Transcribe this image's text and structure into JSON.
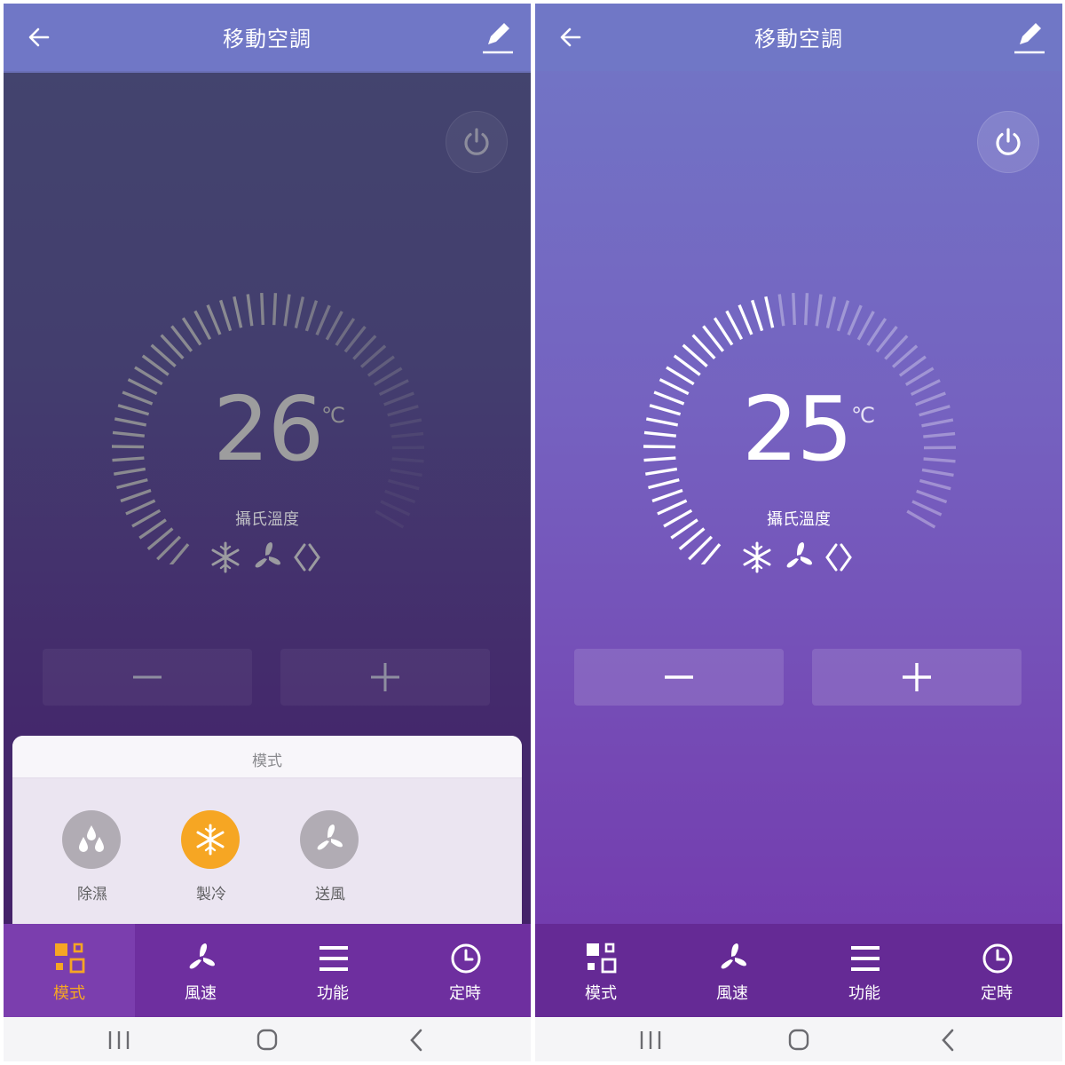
{
  "colors": {
    "accent": "#f6a623",
    "header": "#7077c6",
    "nav_bg": "#6e2f9f"
  },
  "panels": [
    {
      "state": "power-off",
      "header": {
        "title": "移動空調",
        "back_icon": "arrow-left-icon",
        "edit_icon": "pencil-icon"
      },
      "power_icon": "power-icon",
      "temperature": {
        "value": "26",
        "unit": "℃",
        "label": "攝氏溫度"
      },
      "dial": {
        "active_fraction": 0
      },
      "status_icons": [
        "snowflake-icon",
        "fan-icon",
        "swing-icon"
      ],
      "controls": {
        "minus_label": "−",
        "plus_label": "+"
      },
      "mode_sheet": {
        "title": "模式",
        "options": [
          {
            "label": "除濕",
            "icon": "water-drops-icon",
            "selected": false
          },
          {
            "label": "製冷",
            "icon": "snowflake-icon",
            "selected": true
          },
          {
            "label": "送風",
            "icon": "fan-icon",
            "selected": false
          }
        ]
      },
      "bottom_nav": [
        {
          "label": "模式",
          "icon": "mode-grid-icon",
          "active": true
        },
        {
          "label": "風速",
          "icon": "fan-icon",
          "active": false
        },
        {
          "label": "功能",
          "icon": "menu-icon",
          "active": false
        },
        {
          "label": "定時",
          "icon": "clock-icon",
          "active": false
        }
      ]
    },
    {
      "state": "power-on",
      "header": {
        "title": "移動空調",
        "back_icon": "arrow-left-icon",
        "edit_icon": "pencil-icon"
      },
      "power_icon": "power-icon",
      "temperature": {
        "value": "25",
        "unit": "℃",
        "label": "攝氏溫度"
      },
      "dial": {
        "active_fraction": 0.5
      },
      "status_icons": [
        "snowflake-icon",
        "fan-icon",
        "swing-icon"
      ],
      "controls": {
        "minus_label": "−",
        "plus_label": "+"
      },
      "bottom_nav": [
        {
          "label": "模式",
          "icon": "mode-grid-icon",
          "active": false
        },
        {
          "label": "風速",
          "icon": "fan-icon",
          "active": false
        },
        {
          "label": "功能",
          "icon": "menu-icon",
          "active": false
        },
        {
          "label": "定時",
          "icon": "clock-icon",
          "active": false
        }
      ]
    }
  ],
  "system_nav": {
    "recents_icon": "recents-icon",
    "home_icon": "home-icon",
    "back_icon": "chevron-left-icon"
  }
}
